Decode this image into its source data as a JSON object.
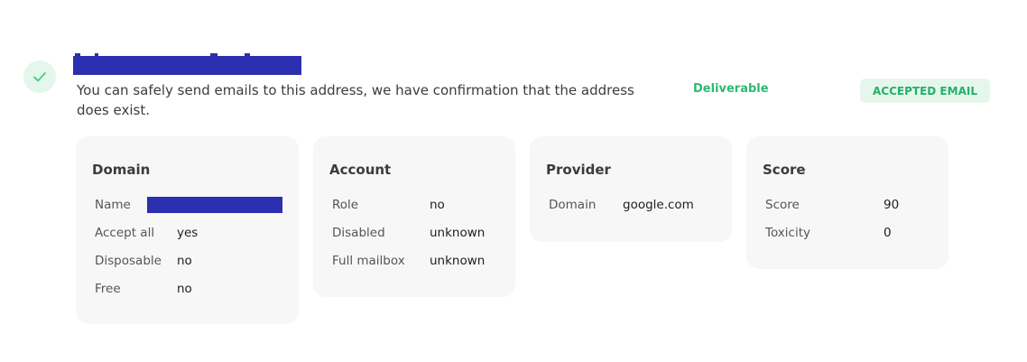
{
  "status": {
    "message": "You can safely send emails to this address, we have confirmation that the address does exist.",
    "state": "Deliverable",
    "badge": "ACCEPTED EMAIL",
    "icon": "checkmark-icon",
    "accent_color": "#2dba72",
    "redaction_color": "#2b2fb0"
  },
  "cards": {
    "domain": {
      "title": "Domain",
      "rows": [
        {
          "label": "Name",
          "value": ""
        },
        {
          "label": "Accept all",
          "value": "yes"
        },
        {
          "label": "Disposable",
          "value": "no"
        },
        {
          "label": "Free",
          "value": "no"
        }
      ]
    },
    "account": {
      "title": "Account",
      "rows": [
        {
          "label": "Role",
          "value": "no"
        },
        {
          "label": "Disabled",
          "value": "unknown"
        },
        {
          "label": "Full mailbox",
          "value": "unknown"
        }
      ]
    },
    "provider": {
      "title": "Provider",
      "rows": [
        {
          "label": "Domain",
          "value": "google.com"
        }
      ]
    },
    "score": {
      "title": "Score",
      "rows": [
        {
          "label": "Score",
          "value": "90"
        },
        {
          "label": "Toxicity",
          "value": "0"
        }
      ]
    }
  }
}
